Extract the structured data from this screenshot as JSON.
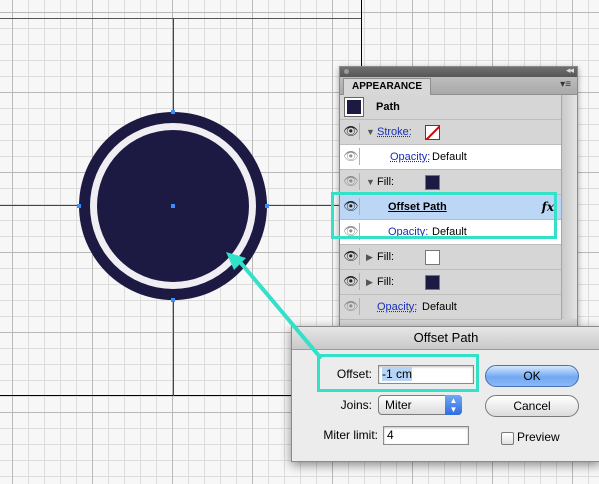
{
  "colors": {
    "fill_navy": "#1c1a43",
    "ring_white": "#f0eef3",
    "highlight_teal": "#33e0c8",
    "selection_blue": "#bcd6f5"
  },
  "appearance_panel": {
    "tab_label": "APPEARANCE",
    "menu_icon": "panel-menu-icon",
    "header_label": "Path",
    "rows": {
      "stroke_label": "Stroke:",
      "stroke_opacity_label": "Opacity:",
      "stroke_opacity_value": "Default",
      "fill1_label": "Fill:",
      "effect_label": "Offset Path",
      "effect_icon": "fx",
      "effect_opacity_label": "Opacity:",
      "effect_opacity_value": "Default",
      "fill2_label": "Fill:",
      "fill3_label": "Fill:",
      "object_opacity_label": "Opacity:",
      "object_opacity_value": "Default"
    }
  },
  "dialog": {
    "title": "Offset Path",
    "offset_label": "Offset:",
    "offset_value": "-1 cm",
    "joins_label": "Joins:",
    "joins_value": "Miter",
    "miter_label": "Miter limit:",
    "miter_value": "4",
    "ok_label": "OK",
    "cancel_label": "Cancel",
    "preview_label": "Preview",
    "preview_checked": false
  }
}
